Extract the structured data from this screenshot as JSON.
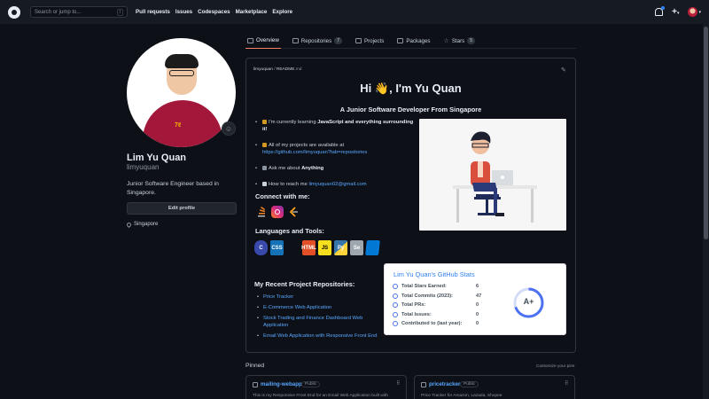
{
  "header": {
    "search_placeholder": "Search or jump to...",
    "search_key": "/",
    "nav": [
      "Pull requests",
      "Issues",
      "Codespaces",
      "Marketplace",
      "Explore"
    ]
  },
  "profile": {
    "fullname": "Lim Yu Quan",
    "username": "limyuquan",
    "bio": "Junior Software Engineer based in Singapore.",
    "edit_label": "Edit profile",
    "location": "Singapore"
  },
  "tabs": [
    {
      "label": "Overview",
      "active": true
    },
    {
      "label": "Repositories",
      "count": "7"
    },
    {
      "label": "Projects"
    },
    {
      "label": "Packages"
    },
    {
      "label": "Stars",
      "count": "5"
    }
  ],
  "readme": {
    "path_user": "limyuquan",
    "path_sep": " / ",
    "path_file": "README",
    "path_ext": ".md",
    "greeting": "Hi 👋, I'm Yu Quan",
    "subtitle": "A Junior Software Developer From Singapore",
    "bullet1_pre": "I'm currently learning ",
    "bullet1_bold": "JavaScript and everything surrounding it!",
    "bullet2_pre": "All of my projects are available at",
    "bullet2_link": "https://github.com/limyuquan?tab=repositories",
    "bullet3_pre": "Ask me about ",
    "bullet3_bold": "Anything",
    "bullet4_pre": "How to reach me ",
    "bullet4_link": "limyuquan02@gmail.com",
    "connect_heading": "Connect with me:",
    "languages_heading": "Languages and Tools:",
    "languages": [
      "C",
      "CSS",
      "",
      "HTML",
      "JS",
      "Py",
      "Se",
      ""
    ],
    "recent_heading": "My Recent Project Repositories:",
    "recent_repos": [
      "Price Tracker",
      "E-Commerce Web Application",
      "Stock Trading and Finance Dashboard Web Application",
      "Email Web Application with Responsive Front End"
    ]
  },
  "stats": {
    "title": "Lim Yu Quan's GitHub Stats",
    "rows": [
      {
        "label": "Total Stars Earned:",
        "value": "6"
      },
      {
        "label": "Total Commits (2023):",
        "value": "47"
      },
      {
        "label": "Total PRs:",
        "value": "0"
      },
      {
        "label": "Total Issues:",
        "value": "0"
      },
      {
        "label": "Contributed to (last year):",
        "value": "0"
      }
    ],
    "grade": "A+"
  },
  "pinned": {
    "heading": "Pinned",
    "customize": "Customize your pins",
    "cards": [
      {
        "name": "mailing-webapp",
        "badge": "Public",
        "desc": "This is my Responsive Front End for an Email Web Application built with"
      },
      {
        "name": "pricetracker",
        "badge": "Public",
        "desc": "Price Tracker for Amazon, Lazada, Shopee"
      }
    ]
  },
  "colors": {
    "accent": "#58a6ff",
    "tab_underline": "#f78166",
    "stats_title": "#2f80ed",
    "ring": "#4c71f2"
  }
}
